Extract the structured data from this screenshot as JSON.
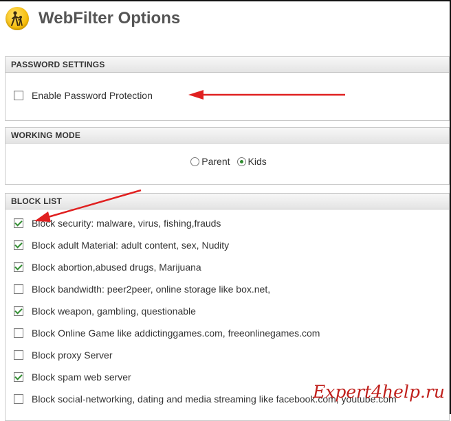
{
  "app": {
    "title": "WebFilter Options",
    "logo_icon": "pedestrian-icon",
    "accent_color": "#f5b800"
  },
  "password_settings": {
    "header": "PASSWORD SETTINGS",
    "checkbox_label": "Enable Password Protection",
    "checked": false
  },
  "working_mode": {
    "header": "WORKING MODE",
    "options": [
      {
        "label": "Parent",
        "selected": false
      },
      {
        "label": "Kids",
        "selected": true
      }
    ]
  },
  "block_list": {
    "header": "BLOCK LIST",
    "items": [
      {
        "label": "Block security: malware, virus, fishing,frauds",
        "checked": true
      },
      {
        "label": "Block adult Material: adult content, sex, Nudity",
        "checked": true
      },
      {
        "label": "Block abortion,abused drugs, Marijuana",
        "checked": true
      },
      {
        "label": "Block bandwidth: peer2peer, online storage like box.net,",
        "checked": false
      },
      {
        "label": "Block weapon, gambling, questionable",
        "checked": true
      },
      {
        "label": "Block Online Game like addictinggames.com, freeonlinegames.com",
        "checked": false
      },
      {
        "label": "Block proxy Server",
        "checked": false
      },
      {
        "label": "Block spam web server",
        "checked": true
      },
      {
        "label": "Block social-networking, dating and media streaming like facebook.com, youtube.com",
        "checked": false
      }
    ]
  },
  "watermark": {
    "text": "Expert4help.ru",
    "color": "#c0201c"
  },
  "annotation": {
    "arrow_color": "#e02020"
  }
}
